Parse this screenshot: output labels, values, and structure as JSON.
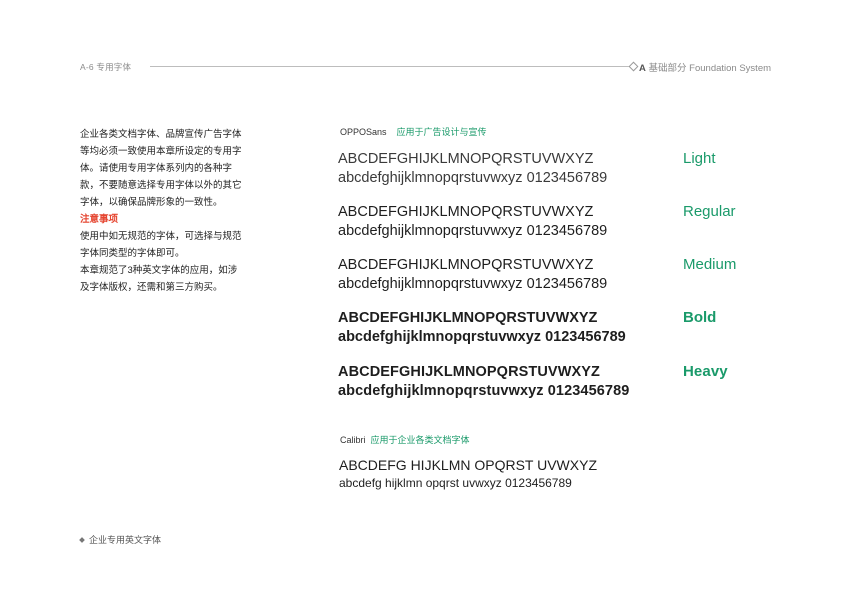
{
  "header": {
    "section_code": "A-6 专用字体",
    "section_prefix": "A",
    "section_title": "基础部分",
    "section_title_en": "Foundation System"
  },
  "intro": {
    "paragraph": "企业各类文档字体、品牌宣传广告字体等均必须一致使用本章所设定的专用字体。请使用专用字体系列内的各种字款，不要随意选择专用字体以外的其它字体，以确保品牌形象的一致性。",
    "note_title": "注意事项",
    "note_lines": [
      "使用中如无规范的字体，可选择与规范字体同类型的字体即可。",
      "本章规范了3种英文字体的应用，如涉及字体版权，还需和第三方购买。"
    ]
  },
  "oppo": {
    "font_name": "OPPOSans",
    "usage": "应用于广告设计与宣传",
    "upper": "ABCDEFGHIJKLMNOPQRSTUVWXYZ",
    "lower": "abcdefghijklmnopqrstuvwxyz 0123456789",
    "weights": [
      "Light",
      "Regular",
      "Medium",
      "Bold",
      "Heavy"
    ]
  },
  "calibri": {
    "font_name": "Calibri",
    "usage": "应用于企业各类文档字体",
    "upper": "ABCDEFG HIJKLMN OPQRST UVWXYZ",
    "lower": "abcdefg hijklmn opqrst uvwxyz 0123456789"
  },
  "footer": {
    "label": "企业专用英文字体"
  },
  "colors": {
    "accent_green": "#1a9a6a",
    "note_red": "#e5442f",
    "gray_text": "#8a8a8a"
  }
}
